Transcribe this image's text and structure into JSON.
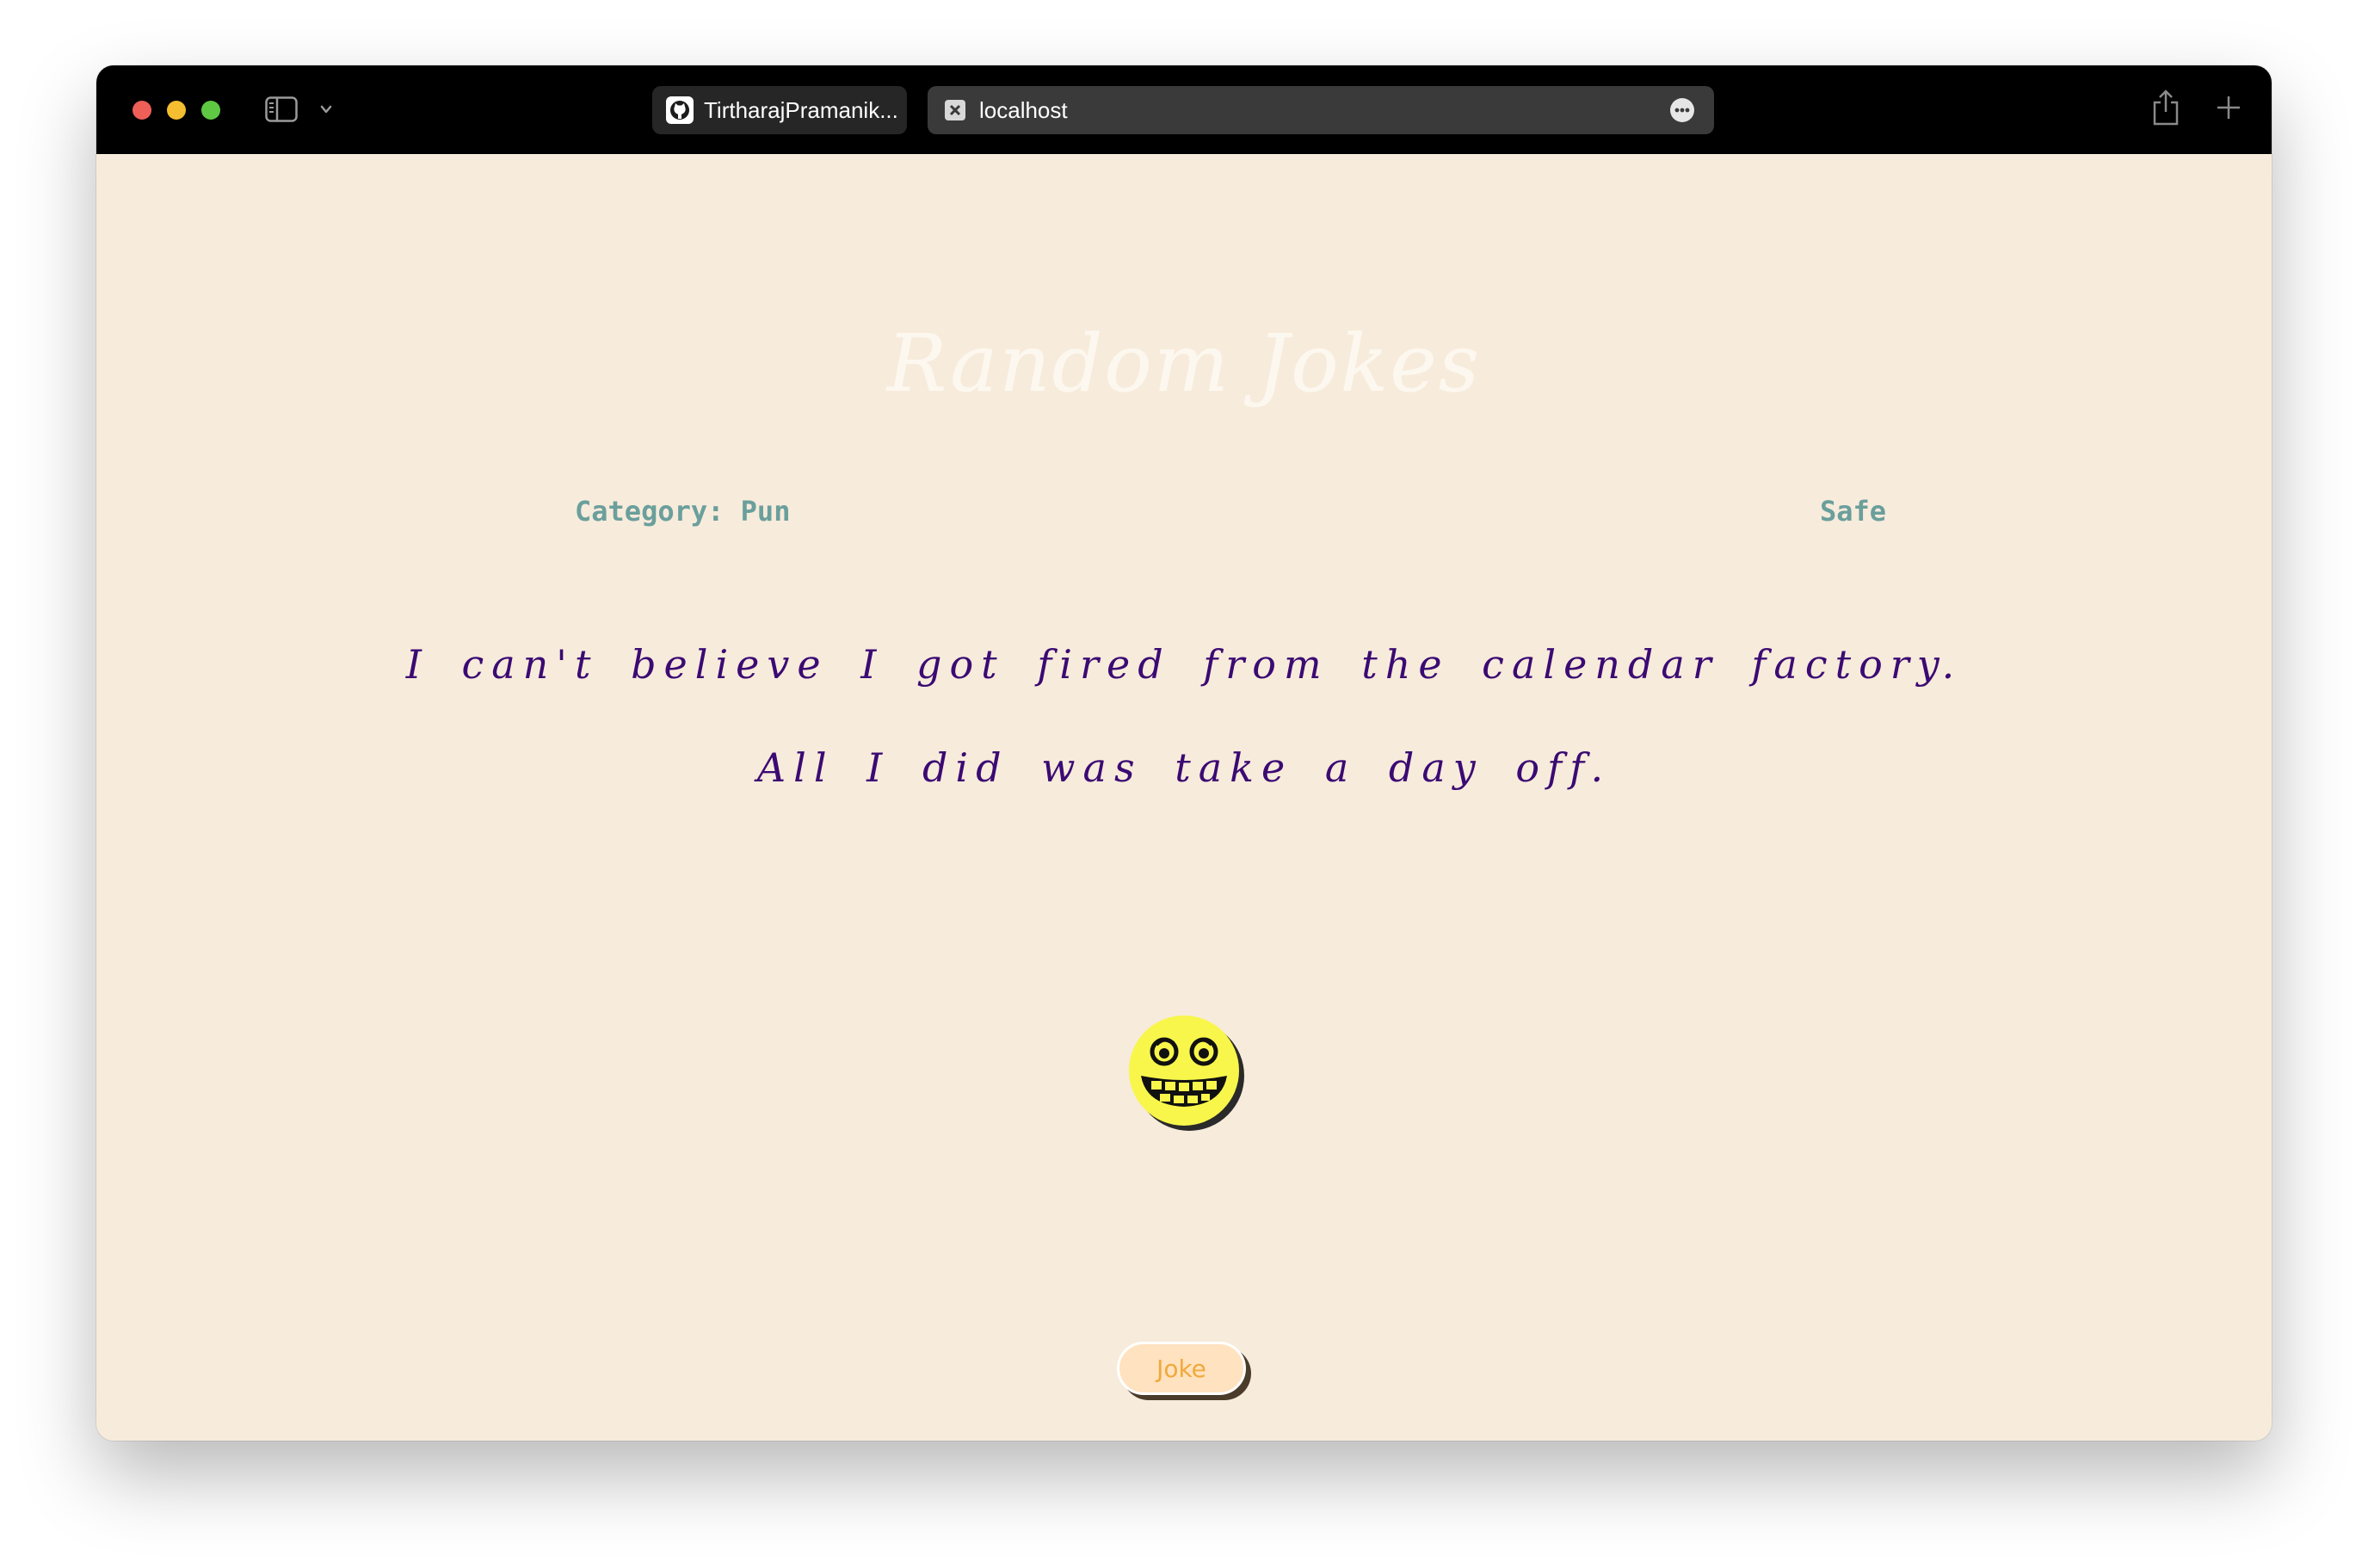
{
  "browser": {
    "tabs": [
      {
        "label": "TirtharajPramanik...",
        "icon": "github-icon",
        "active": false
      },
      {
        "label": "localhost",
        "icon": "close-tab-icon",
        "active": true
      }
    ]
  },
  "page": {
    "title": "Random Jokes",
    "category_label": "Category: Pun",
    "safety_label": "Safe",
    "joke_setup": "I can't believe I got fired from the calendar factory.",
    "joke_delivery": "All I did was take a day off.",
    "emoji_icon": "grinning-face-icon",
    "button_label": "Joke"
  },
  "colors": {
    "background": "#f7ebdb",
    "joke_text": "#3b0a73",
    "meta_text": "#6a9f9c",
    "button_bg": "#ffe2bf",
    "button_text": "#f0a93c",
    "emoji_yellow": "#f8f64a"
  }
}
